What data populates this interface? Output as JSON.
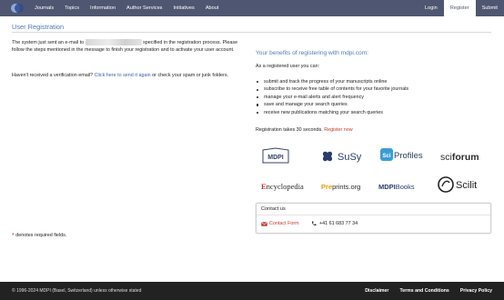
{
  "nav": {
    "items": [
      "Journals",
      "Topics",
      "Information",
      "Author Services",
      "Initiatives",
      "About"
    ],
    "login": "Login",
    "register": "Register",
    "submit": "Submit"
  },
  "page": {
    "title": "User Registration"
  },
  "message": {
    "line1_before": "The system just sent an e-mail to",
    "line1_after": "specified in the registration process.",
    "line2": "Please follow the steps mentioned in the message to finish your registration and to activate your user account.",
    "resend_before": "Haven't received a verification email?",
    "resend_link": "Click here to send it again",
    "resend_after": "or check your spam or junk folders."
  },
  "required_note": "denotes required fields.",
  "benefits": {
    "title": "Your benefits of registering with mdpi.com:",
    "intro": "As a registered user you can:",
    "items": [
      "submit and track the progress of your manuscripts online",
      "subscribe to receive free table of contents for your favorite journals",
      "manage your e-mail alerts and alert frequency",
      "save and manage your search queries",
      "receive new publications matching your search queries"
    ],
    "takes_before": "Registration takes 30 seconds.",
    "register_now": "Register now"
  },
  "brands": {
    "mdpi": "MDPI",
    "susy": "SuSy",
    "sciprofiles_sci": "Sci",
    "sciprofiles_rest": "Profiles",
    "sciforum_sci": "sci",
    "sciforum_rest": "forum",
    "encyclopedia_e": "E",
    "encyclopedia_rest": "ncyclopedia",
    "preprints_pre": "Pre",
    "preprints_rest": "prints.org",
    "mdpibooks_mdpi": "MDPI",
    "mdpibooks_books": "Books",
    "scilit": "Scilit"
  },
  "contact": {
    "title": "Contact us",
    "form": "Contact Form",
    "phone": "+41 61 683 77 34"
  },
  "footer": {
    "copyright": "© 1996-2024 MDPI (Basel, Switzerland) unless otherwise stated",
    "links": [
      "Disclaimer",
      "Terms and Conditions",
      "Privacy Policy"
    ]
  },
  "colors": {
    "nav_bg": "#4f5671",
    "accent_blue": "#4f7ab8",
    "link_red": "#c0392b",
    "footer_bg": "#222222"
  }
}
